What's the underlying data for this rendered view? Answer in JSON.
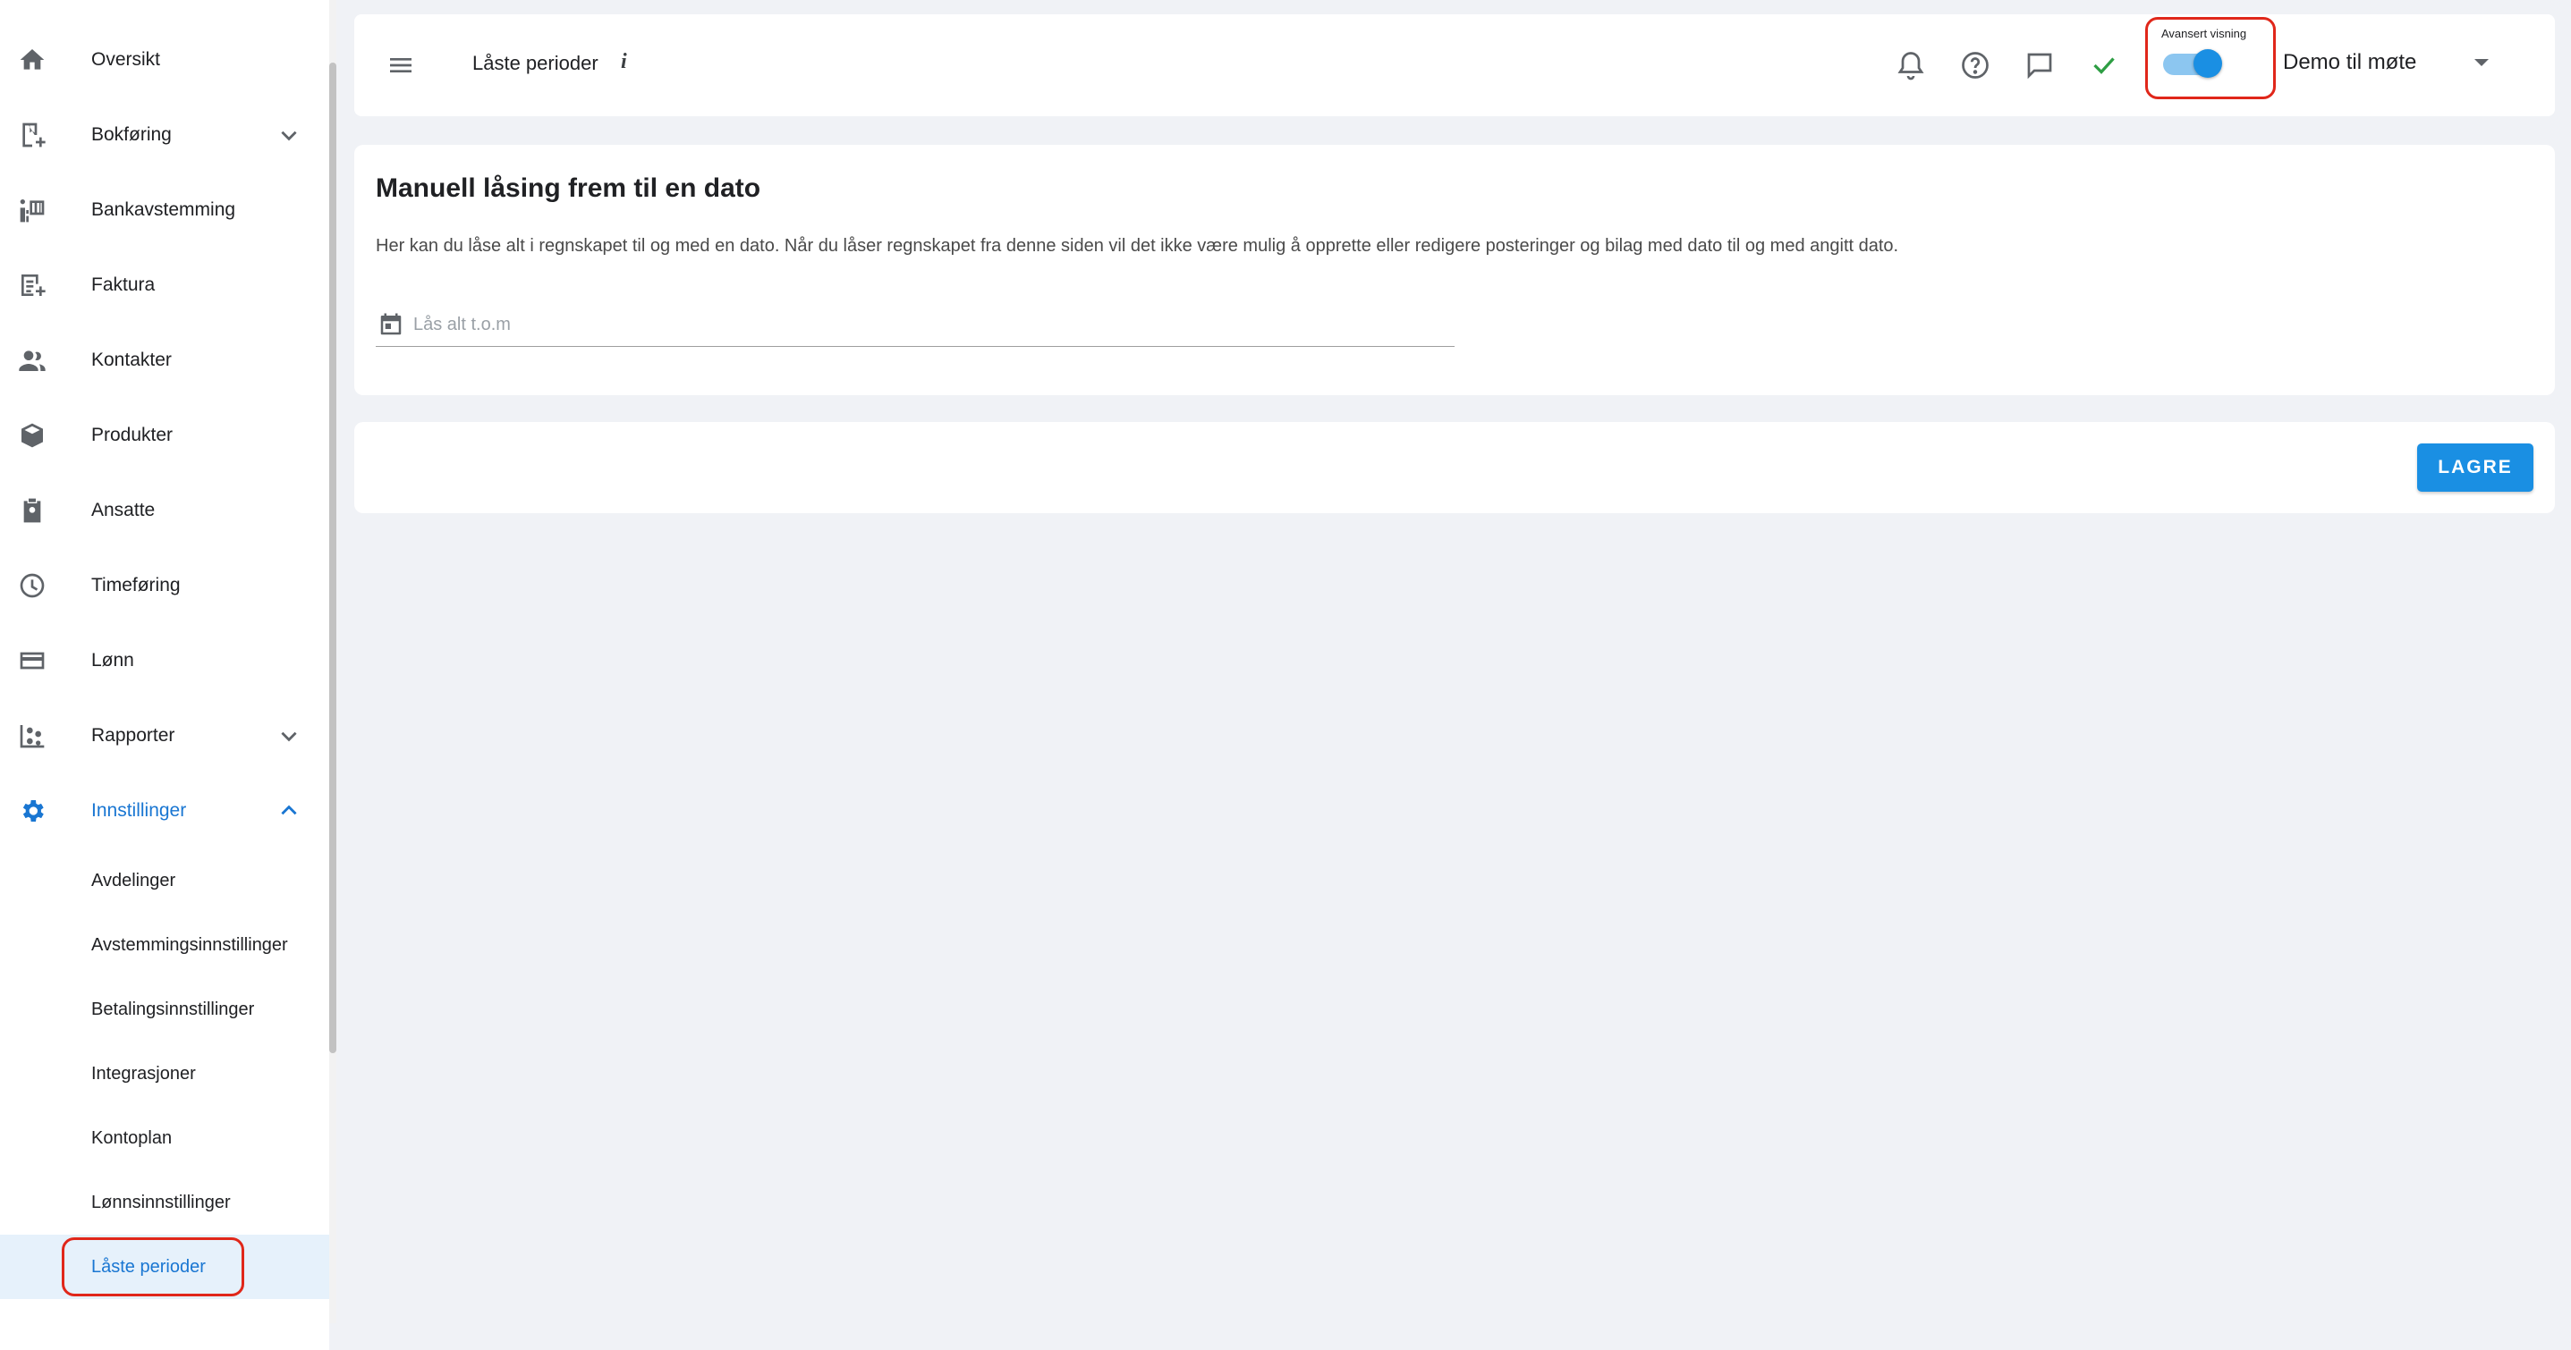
{
  "sidebar": {
    "items": [
      {
        "label": "Oversikt",
        "icon": "home-icon"
      },
      {
        "label": "Bokføring",
        "icon": "bookkeeping-icon",
        "expandable": true
      },
      {
        "label": "Bankavstemming",
        "icon": "bank-reconciliation-icon"
      },
      {
        "label": "Faktura",
        "icon": "invoice-icon"
      },
      {
        "label": "Kontakter",
        "icon": "contacts-icon"
      },
      {
        "label": "Produkter",
        "icon": "products-icon"
      },
      {
        "label": "Ansatte",
        "icon": "employees-icon"
      },
      {
        "label": "Timeføring",
        "icon": "clock-icon"
      },
      {
        "label": "Lønn",
        "icon": "payment-card-icon"
      },
      {
        "label": "Rapporter",
        "icon": "reports-icon",
        "expandable": true
      },
      {
        "label": "Innstillinger",
        "icon": "gear-icon",
        "expandable": true,
        "expanded": true,
        "active": true
      }
    ],
    "sub_items": [
      {
        "label": "Avdelinger"
      },
      {
        "label": "Avstemmingsinnstillinger"
      },
      {
        "label": "Betalingsinnstillinger"
      },
      {
        "label": "Integrasjoner"
      },
      {
        "label": "Kontoplan"
      },
      {
        "label": "Lønnsinnstillinger"
      },
      {
        "label": "Låste perioder",
        "selected": true
      }
    ]
  },
  "header": {
    "title": "Låste perioder",
    "info_glyph": "i",
    "toggle_label": "Avansert visning",
    "toggle_on": true,
    "company": "Demo til møte",
    "icons": [
      "menu-icon",
      "bell-icon",
      "help-icon",
      "chat-icon",
      "check-icon",
      "chevron-down-icon"
    ]
  },
  "main": {
    "title": "Manuell låsing frem til en dato",
    "description": "Her kan du låse alt i regnskapet til og med en dato. Når du låser regnskapet fra denne siden vil det ikke være mulig å opprette eller redigere posteringer og bilag med dato til og med angitt dato.",
    "date_field": {
      "placeholder": "Lås alt t.o.m",
      "value": ""
    }
  },
  "actions": {
    "save_label": "LAGRE"
  },
  "colors": {
    "accent": "#1a8fe3",
    "active_text": "#1976d2",
    "selected_bg": "#e6f1fb",
    "highlight": "#e0271a",
    "success": "#2e9e44",
    "page_bg": "#f0f2f6"
  }
}
